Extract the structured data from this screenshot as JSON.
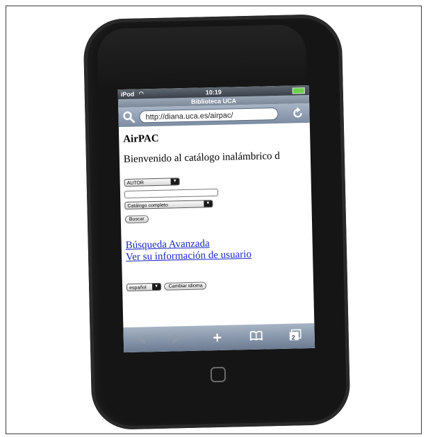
{
  "status_bar": {
    "carrier": "iPod",
    "time": "10:19"
  },
  "browser": {
    "page_title": "Biblioteca UCA",
    "url": "http://diana.uca.es/airpac/"
  },
  "page": {
    "site_title": "AirPAC",
    "welcome": "Bienvenido al catálogo inalámbrico d",
    "search_field_select": "AUTOR",
    "catalog_select": "Catálogo completo",
    "search_button": "Buscar",
    "advanced_link": "Búsqueda Avanzada",
    "user_link": "Ver su información de usuario",
    "language_select": "español",
    "change_language_button": "Cambiar idioma"
  },
  "toolbar": {
    "tabs_count": "2"
  },
  "icons": [
    "wifi-icon",
    "battery-icon",
    "search-icon",
    "reload-icon",
    "back-icon",
    "forward-icon",
    "add-icon",
    "bookmarks-icon",
    "tabs-icon",
    "home-button-icon"
  ]
}
